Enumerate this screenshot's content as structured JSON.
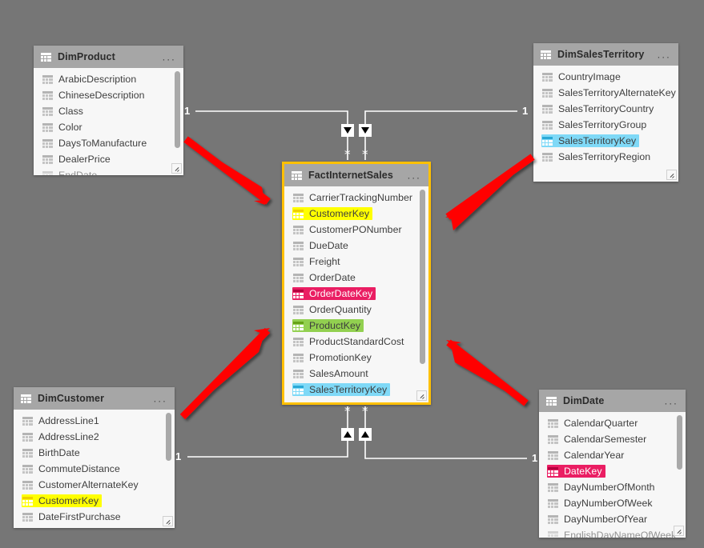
{
  "app": {
    "view": "Model relationships diagram",
    "background_color": "#767676"
  },
  "tables": [
    {
      "id": "dimproduct",
      "title": "DimProduct",
      "menu": "...",
      "selected": false,
      "fields": [
        {
          "name": "ArabicDescription",
          "highlight": "none"
        },
        {
          "name": "ChineseDescription",
          "highlight": "none"
        },
        {
          "name": "Class",
          "highlight": "none"
        },
        {
          "name": "Color",
          "highlight": "none"
        },
        {
          "name": "DaysToManufacture",
          "highlight": "none"
        },
        {
          "name": "DealerPrice",
          "highlight": "none"
        },
        {
          "name": "EndDate",
          "highlight": "none",
          "partial": true
        }
      ]
    },
    {
      "id": "dimsalesterritory",
      "title": "DimSalesTerritory",
      "menu": "...",
      "selected": false,
      "fields": [
        {
          "name": "CountryImage",
          "highlight": "none"
        },
        {
          "name": "SalesTerritoryAlternateKey",
          "highlight": "none"
        },
        {
          "name": "SalesTerritoryCountry",
          "highlight": "none"
        },
        {
          "name": "SalesTerritoryGroup",
          "highlight": "none"
        },
        {
          "name": "SalesTerritoryKey",
          "highlight": "cyan"
        },
        {
          "name": "SalesTerritoryRegion",
          "highlight": "none"
        }
      ]
    },
    {
      "id": "factinternetsales",
      "title": "FactInternetSales",
      "menu": "...",
      "selected": true,
      "fields": [
        {
          "name": "CarrierTrackingNumber",
          "highlight": "none"
        },
        {
          "name": "CustomerKey",
          "highlight": "yellow"
        },
        {
          "name": "CustomerPONumber",
          "highlight": "none"
        },
        {
          "name": "DueDate",
          "highlight": "none"
        },
        {
          "name": "Freight",
          "highlight": "none"
        },
        {
          "name": "OrderDate",
          "highlight": "none"
        },
        {
          "name": "OrderDateKey",
          "highlight": "pink"
        },
        {
          "name": "OrderQuantity",
          "highlight": "none"
        },
        {
          "name": "ProductKey",
          "highlight": "green"
        },
        {
          "name": "ProductStandardCost",
          "highlight": "none"
        },
        {
          "name": "PromotionKey",
          "highlight": "none"
        },
        {
          "name": "SalesAmount",
          "highlight": "none"
        },
        {
          "name": "SalesTerritoryKey",
          "highlight": "cyan"
        }
      ]
    },
    {
      "id": "dimcustomer",
      "title": "DimCustomer",
      "menu": "...",
      "selected": false,
      "fields": [
        {
          "name": "AddressLine1",
          "highlight": "none"
        },
        {
          "name": "AddressLine2",
          "highlight": "none"
        },
        {
          "name": "BirthDate",
          "highlight": "none"
        },
        {
          "name": "CommuteDistance",
          "highlight": "none"
        },
        {
          "name": "CustomerAlternateKey",
          "highlight": "none"
        },
        {
          "name": "CustomerKey",
          "highlight": "yellow"
        },
        {
          "name": "DateFirstPurchase",
          "highlight": "none"
        }
      ]
    },
    {
      "id": "dimdate",
      "title": "DimDate",
      "menu": "...",
      "selected": false,
      "fields": [
        {
          "name": "CalendarQuarter",
          "highlight": "none"
        },
        {
          "name": "CalendarSemester",
          "highlight": "none"
        },
        {
          "name": "CalendarYear",
          "highlight": "none"
        },
        {
          "name": "DateKey",
          "highlight": "pink"
        },
        {
          "name": "DayNumberOfMonth",
          "highlight": "none"
        },
        {
          "name": "DayNumberOfWeek",
          "highlight": "none"
        },
        {
          "name": "DayNumberOfYear",
          "highlight": "none"
        },
        {
          "name": "EnglishDayNameOfWeek",
          "highlight": "none",
          "partial": true
        }
      ]
    }
  ],
  "relationships": [
    {
      "id": "rel-product-fact",
      "one_label": "1",
      "many_label": "*",
      "direction": "down"
    },
    {
      "id": "rel-territory-fact",
      "one_label": "1",
      "many_label": "*",
      "direction": "down"
    },
    {
      "id": "rel-customer-fact",
      "one_label": "1",
      "many_label": "*",
      "direction": "up"
    },
    {
      "id": "rel-date-fact",
      "one_label": "1",
      "many_label": "*",
      "direction": "up"
    }
  ],
  "annotations": {
    "arrow_color": "#ff0000",
    "arrows": [
      {
        "id": "arrow-top-left",
        "points_to": "CustomerKey in FactInternetSales"
      },
      {
        "id": "arrow-top-right",
        "points_to": "SalesTerritoryKey highlight"
      },
      {
        "id": "arrow-bottom-left",
        "points_to": "ProductKey in FactInternetSales"
      },
      {
        "id": "arrow-bottom-right",
        "points_to": "FactInternetSales right edge"
      }
    ]
  },
  "highlight_colors": {
    "yellow": "#ffff00",
    "green": "#92d050",
    "cyan": "#7fd9f7",
    "pink": "#ea1e63",
    "selected_border": "#ffc000"
  }
}
